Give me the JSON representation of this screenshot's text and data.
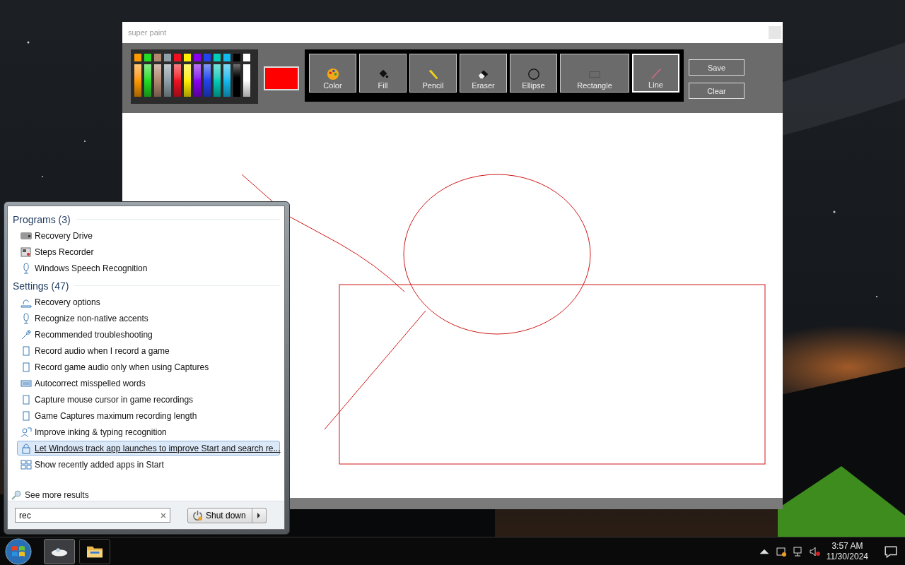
{
  "window": {
    "title": "super paint"
  },
  "palette": [
    {
      "color": "#ff9900"
    },
    {
      "color": "#22dd22"
    },
    {
      "color": "#b08870"
    },
    {
      "color": "#90a0a8"
    },
    {
      "color": "#ee1122"
    },
    {
      "color": "#ffee00"
    },
    {
      "color": "#8800ee"
    },
    {
      "color": "#2244ee"
    },
    {
      "color": "#00ccbb"
    },
    {
      "color": "#11bbee"
    },
    {
      "color": "#000000"
    },
    {
      "color": "#ffffff"
    }
  ],
  "current_color": {
    "color": "#ff0000"
  },
  "tools": [
    {
      "kind": "palette",
      "label": "Color",
      "selected": false
    },
    {
      "kind": "fill",
      "label": "Fill",
      "selected": false
    },
    {
      "kind": "pencil",
      "label": "Pencil",
      "selected": false
    },
    {
      "kind": "eraser",
      "label": "Eraser",
      "selected": false
    },
    {
      "kind": "ellipse",
      "label": "Ellipse",
      "selected": false
    },
    {
      "kind": "rectangle",
      "label": "Rectangle",
      "selected": false
    },
    {
      "kind": "line",
      "label": "Line",
      "selected": true
    }
  ],
  "buttons": [
    "Save",
    "Clear"
  ],
  "start_menu": {
    "sections": [
      {
        "heading": "Programs (3)",
        "items": [
          {
            "kind": "drive",
            "label": "Recovery Drive",
            "selected": false
          },
          {
            "kind": "steps",
            "label": "Steps Recorder",
            "selected": false
          },
          {
            "kind": "mic",
            "label": "Windows Speech Recognition",
            "selected": false
          }
        ]
      },
      {
        "heading": "Settings (47)",
        "items": [
          {
            "kind": "recovery",
            "label": "Recovery options",
            "selected": false
          },
          {
            "kind": "mic",
            "label": "Recognize non-native accents",
            "selected": false
          },
          {
            "kind": "wrench",
            "label": "Recommended troubleshooting",
            "selected": false
          },
          {
            "kind": "device",
            "label": "Record audio when I record a game",
            "selected": false
          },
          {
            "kind": "device",
            "label": "Record game audio only when using Captures",
            "selected": false
          },
          {
            "kind": "keyboard",
            "label": "Autocorrect misspelled words",
            "selected": false
          },
          {
            "kind": "device",
            "label": "Capture mouse cursor in game recordings",
            "selected": false
          },
          {
            "kind": "device",
            "label": "Game Captures maximum recording length",
            "selected": false
          },
          {
            "kind": "inking",
            "label": "Improve inking & typing recognition",
            "selected": false
          },
          {
            "kind": "lock",
            "label": "Let Windows track app launches to improve Start and search re...",
            "selected": true
          },
          {
            "kind": "tiles",
            "label": "Show recently added apps in Start",
            "selected": false
          }
        ]
      }
    ],
    "see_more": "See more results",
    "search": {
      "value": "rec"
    },
    "shutdown": "Shut down"
  },
  "taskbar": {
    "apps": [
      {
        "kind": "paint",
        "selected": true
      },
      {
        "kind": "folder",
        "selected": false
      }
    ],
    "time": "3:57 AM",
    "date": "11/30/2024"
  }
}
